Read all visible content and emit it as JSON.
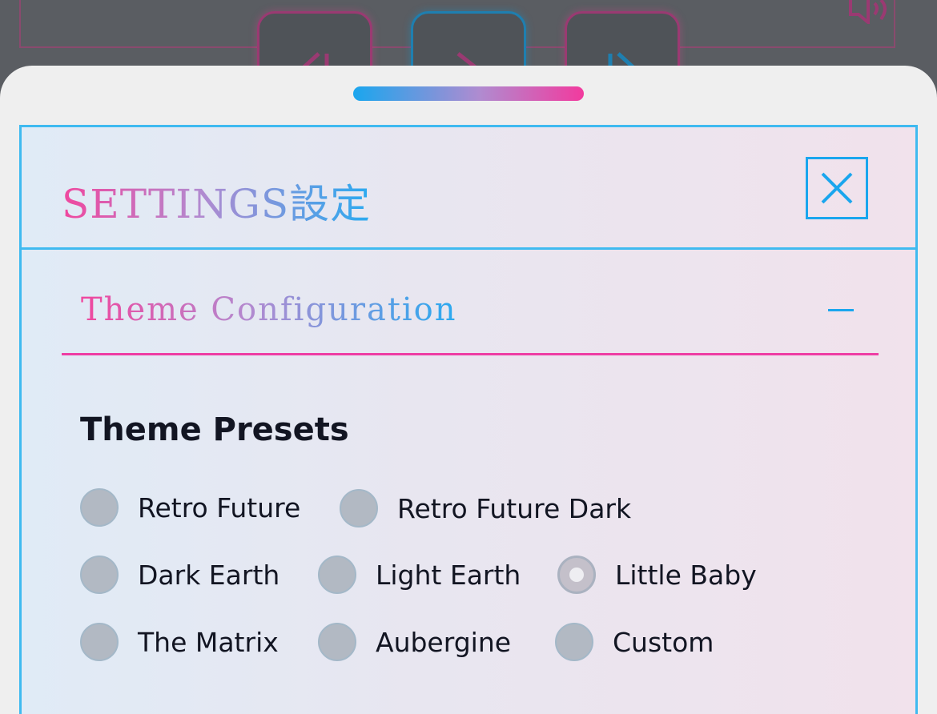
{
  "background": {
    "transport_buttons": [
      "previous",
      "play",
      "next"
    ],
    "volume_icon": "speaker-icon"
  },
  "settings": {
    "title": "SETTINGS設定",
    "close_icon": "close-icon",
    "section": {
      "title": "Theme Configuration",
      "toggle_icon": "minus-icon"
    },
    "presets": {
      "heading": "Theme Presets",
      "options": [
        {
          "label": "Retro Future",
          "selected": false
        },
        {
          "label": "Retro Future Dark",
          "selected": false
        },
        {
          "label": "Dark Earth",
          "selected": false
        },
        {
          "label": "Light Earth",
          "selected": false
        },
        {
          "label": "Little Baby",
          "selected": true
        },
        {
          "label": "The Matrix",
          "selected": false
        },
        {
          "label": "Aubergine",
          "selected": false
        },
        {
          "label": "Custom",
          "selected": false
        }
      ]
    }
  },
  "colors": {
    "accent_blue": "#1aa6ee",
    "accent_pink": "#ee3da4",
    "text_dark": "#121522"
  }
}
